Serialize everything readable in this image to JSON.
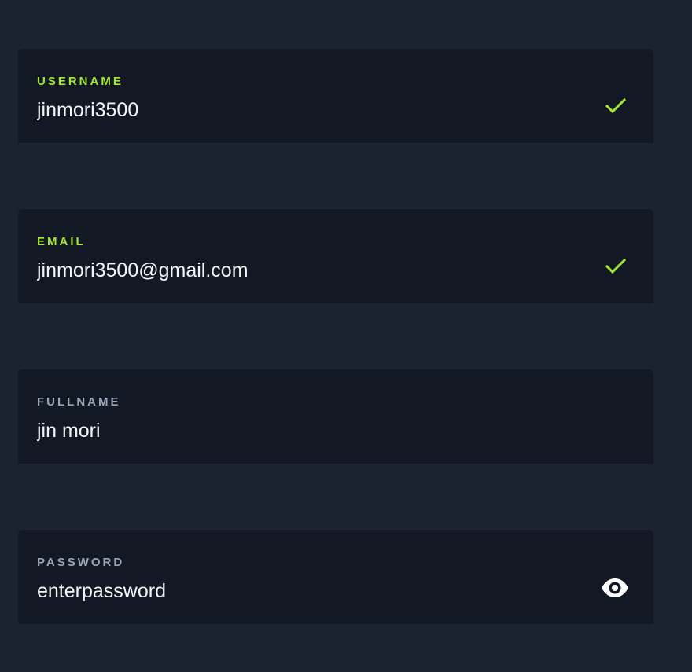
{
  "form": {
    "username": {
      "label": "USERNAME",
      "value": "jinmori3500",
      "status_icon": "check-icon"
    },
    "email": {
      "label": "EMAIL",
      "value": "jinmori3500@gmail.com",
      "status_icon": "check-icon"
    },
    "fullname": {
      "label": "FULLNAME",
      "value": "jin mori"
    },
    "password": {
      "label": "PASSWORD",
      "value": "enterpassword",
      "toggle_icon": "eye-icon"
    }
  },
  "colors": {
    "background": "#1b2230",
    "field_background": "#121925",
    "valid_accent": "#a3e635",
    "neutral_label": "#9aa6b8",
    "text": "#f3f4f6",
    "icon": "#ffffff"
  }
}
